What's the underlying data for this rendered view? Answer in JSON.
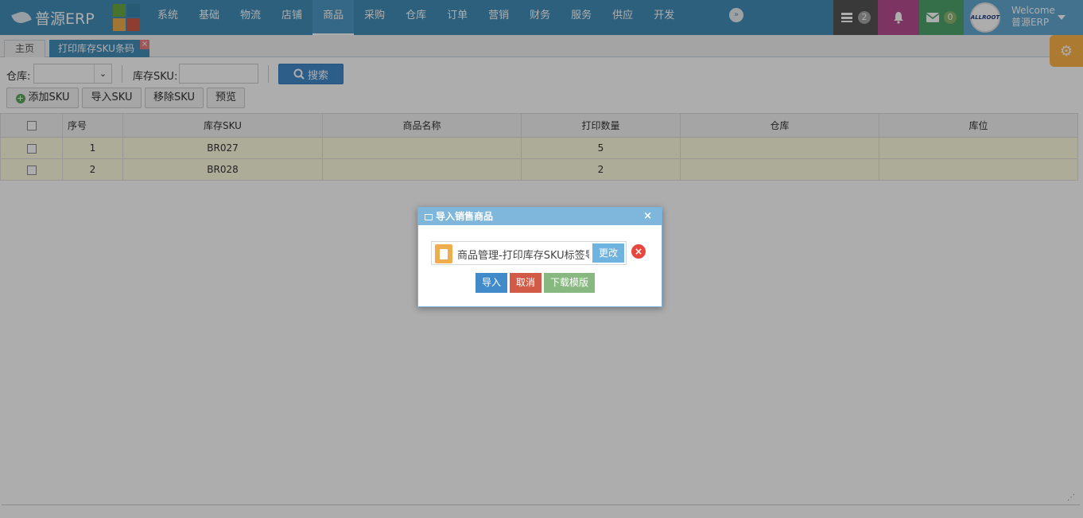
{
  "brand": {
    "name": "普源ERP"
  },
  "tile_colors": [
    "#69aa46",
    "#3a87ad",
    "#f0ad4e",
    "#d15b47"
  ],
  "nav": {
    "items": [
      "系统",
      "基础",
      "物流",
      "店铺",
      "商品",
      "采购",
      "仓库",
      "订单",
      "营销",
      "财务",
      "服务",
      "供应",
      "开发"
    ],
    "active": "商品",
    "more_icon": "double-chevron-right-icon"
  },
  "header_right": {
    "tasks_count": "2",
    "mail_count": "0",
    "avatar_text": "ALLROOT",
    "welcome": "Welcome",
    "user": "普源ERP"
  },
  "tabs": {
    "home": "主页",
    "active": "打印库存SKU条码",
    "close": "×"
  },
  "filters": {
    "warehouse_label": "仓库:",
    "warehouse_value": "",
    "sku_label": "库存SKU:",
    "sku_value": "",
    "search_button": "搜索"
  },
  "actions": {
    "add": "添加SKU",
    "import": "导入SKU",
    "remove": "移除SKU",
    "preview": "预览"
  },
  "table": {
    "columns": [
      "序号",
      "库存SKU",
      "商品名称",
      "打印数量",
      "仓库",
      "库位"
    ],
    "rows": [
      {
        "no": "1",
        "sku": "BR027",
        "name": "",
        "qty": "5",
        "warehouse": "",
        "location": ""
      },
      {
        "no": "2",
        "sku": "BR028",
        "name": "",
        "qty": "2",
        "warehouse": "",
        "location": ""
      }
    ]
  },
  "dialog": {
    "title": "导入销售商品",
    "close": "×",
    "file_name": "商品管理-打印库存SKU标签导入模版.xls",
    "change_button": "更改",
    "clear": "×",
    "import_button": "导入",
    "cancel_button": "取消",
    "download_button": "下载模版"
  },
  "colors": {
    "navbar": "#438eb9",
    "row_highlight": "#fffee0",
    "primary": "#428bca",
    "danger": "#d15b47",
    "success": "#87b87f"
  }
}
